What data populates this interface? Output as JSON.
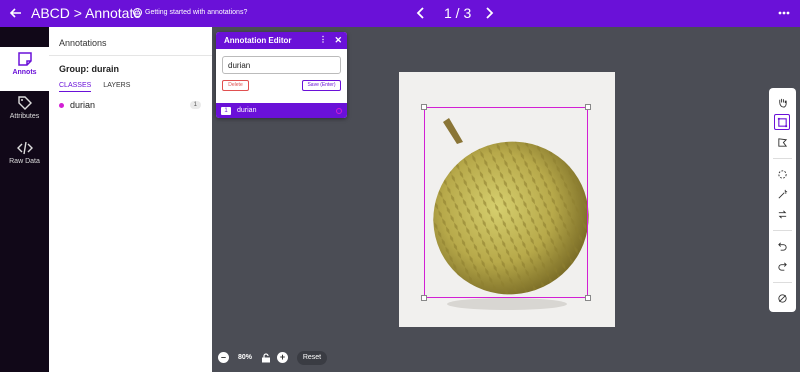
{
  "topbar": {
    "title": "ABCD > Annotate",
    "help_text": "Getting started with annotations?",
    "pager": "1 / 3"
  },
  "rail": {
    "items": [
      {
        "label": "Annots",
        "icon": "note-icon",
        "active": true
      },
      {
        "label": "Attributes",
        "icon": "tag-icon",
        "active": false
      },
      {
        "label": "Raw Data",
        "icon": "code-icon",
        "active": false
      }
    ]
  },
  "panel": {
    "heading": "Annotations",
    "group": "Group: durain",
    "tabs": [
      "CLASSES",
      "LAYERS"
    ],
    "classes": [
      {
        "name": "durian",
        "count": "1",
        "color": "#d21fd4"
      }
    ]
  },
  "editor": {
    "title": "Annotation Editor",
    "input_value": "durian",
    "delete_label": "Delete",
    "save_label": "Save (Enter)",
    "row": {
      "index": "1",
      "label": "durian"
    }
  },
  "zoom": {
    "level": "80%",
    "reset_label": "Reset"
  },
  "colors": {
    "accent": "#6a11d8",
    "bbox": "#d21fd4",
    "canvas_bg": "#4b4d55"
  },
  "tools": [
    "hand-icon",
    "bounding-box-icon",
    "polygon-icon",
    "magic-select-icon",
    "magic-wand-icon",
    "swap-icon",
    "undo-icon",
    "redo-icon",
    "hide-icon"
  ]
}
